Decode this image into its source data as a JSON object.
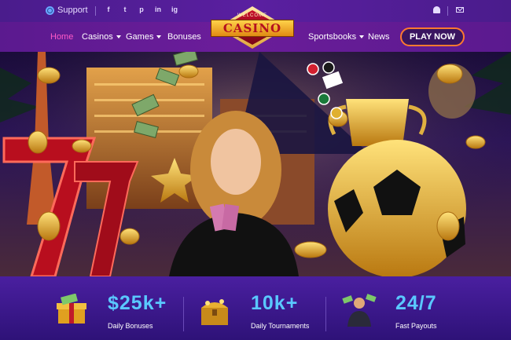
{
  "topbar": {
    "support_label": "Support",
    "socials": [
      "f",
      "t",
      "p",
      "in",
      "ig"
    ],
    "icons": [
      "globe-icon",
      "facebook-icon",
      "twitter-icon",
      "pinterest-icon",
      "linkedin-icon",
      "instagram-icon",
      "bell-icon",
      "mail-icon"
    ]
  },
  "logo": {
    "top_text": "WELCOME",
    "name": "CASINO"
  },
  "nav": {
    "items": [
      {
        "label": "Home",
        "active": true
      },
      {
        "label": "Casinos",
        "dropdown": true
      },
      {
        "label": "Games",
        "dropdown": true
      },
      {
        "label": "Bonuses"
      },
      {
        "label": "Sportsbooks",
        "dropdown": true
      },
      {
        "label": "News"
      }
    ],
    "cta_label": "PLAY NOW"
  },
  "stats": [
    {
      "value": "$25k+",
      "label": "Daily Bonuses",
      "icon": "money-gift-icon"
    },
    {
      "value": "10k+",
      "label": "Daily Tournaments",
      "icon": "treasure-chest-icon"
    },
    {
      "value": "24/7",
      "label": "Fast Payouts",
      "icon": "payout-person-icon"
    }
  ],
  "colors": {
    "accent_pink": "#ff5ac8",
    "cta_border": "#ff7a2f",
    "stat_blue": "#5ac8ff",
    "nav_bg": "#6b1d9a"
  }
}
